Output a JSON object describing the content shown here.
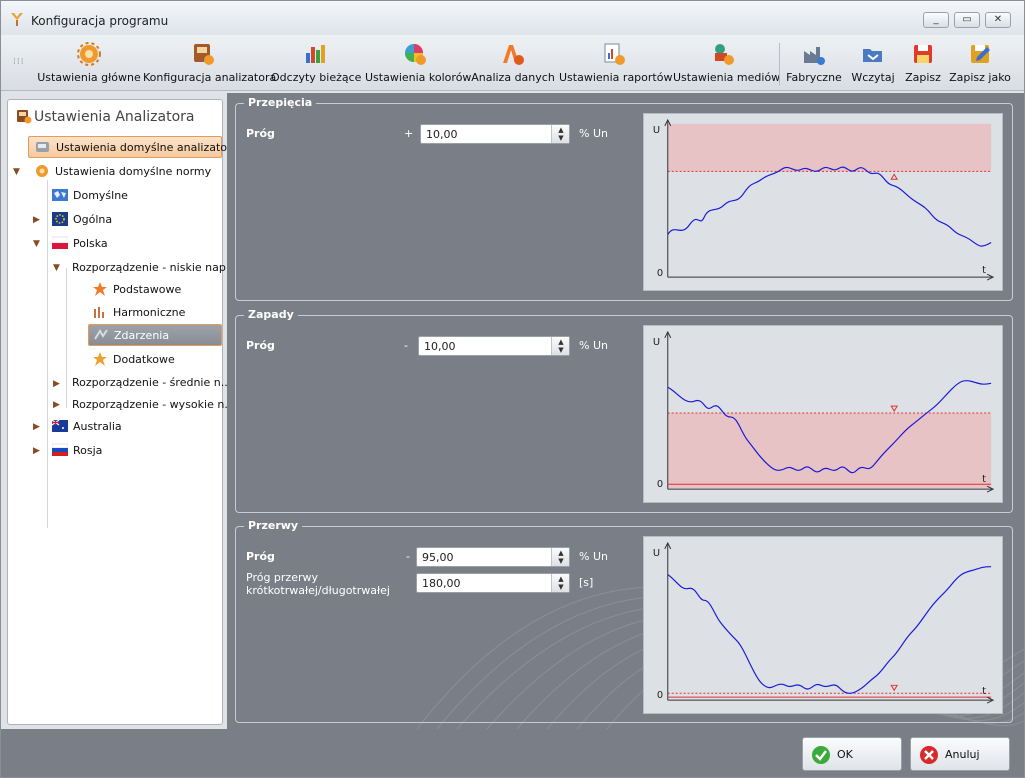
{
  "window": {
    "title": "Konfiguracja programu",
    "controls": [
      "_",
      "▭",
      "✕"
    ]
  },
  "toolbar": {
    "items": [
      {
        "label": "Ustawienia główne",
        "icon": "gear-settings-icon"
      },
      {
        "label": "Konfiguracja analizatora",
        "icon": "analyzer-config-icon"
      },
      {
        "label": "Odczyty bieżące",
        "icon": "current-readings-icon"
      },
      {
        "label": "Ustawienia kolorów",
        "icon": "color-wheel-icon"
      },
      {
        "label": "Analiza danych",
        "icon": "data-analysis-icon"
      },
      {
        "label": "Ustawienia raportów",
        "icon": "report-settings-icon"
      },
      {
        "label": "Ustawienia mediów",
        "icon": "media-settings-icon"
      },
      {
        "label": "Fabryczne",
        "icon": "factory-icon"
      },
      {
        "label": "Wczytaj",
        "icon": "load-icon"
      },
      {
        "label": "Zapisz",
        "icon": "save-icon"
      },
      {
        "label": "Zapisz jako",
        "icon": "save-as-icon"
      }
    ]
  },
  "tree": {
    "title": "Ustawienia Analizatora",
    "nodes": [
      {
        "label": "Ustawienia domyślne analizatora",
        "icon": "analyzer-icon"
      },
      {
        "label": "Ustawienia domyślne normy",
        "icon": "norm-gear-icon"
      },
      {
        "label": "Domyślne",
        "icon": "world-map-icon"
      },
      {
        "label": "Ogólna",
        "icon": "globe-eu-icon"
      },
      {
        "label": "Polska",
        "icon": "flag-poland-icon"
      },
      {
        "label": "Rozporządzenie - niskie nap...",
        "icon": ""
      },
      {
        "label": "Podstawowe",
        "icon": "star-gear-icon"
      },
      {
        "label": "Harmoniczne",
        "icon": "harmonics-icon"
      },
      {
        "label": "Zdarzenia",
        "icon": "events-icon"
      },
      {
        "label": "Dodatkowe",
        "icon": "star-icon"
      },
      {
        "label": "Rozporządzenie - średnie n...",
        "icon": ""
      },
      {
        "label": "Rozporządzenie - wysokie n...",
        "icon": ""
      },
      {
        "label": "Australia",
        "icon": "flag-australia-icon"
      },
      {
        "label": "Rosja",
        "icon": "flag-russia-icon"
      }
    ]
  },
  "sections": {
    "przepiecia": {
      "title": "Przepięcia",
      "label": "Próg",
      "sign": "+",
      "value": "10,00",
      "unit": "% Un"
    },
    "zapady": {
      "title": "Zapady",
      "label": "Próg",
      "sign": "-",
      "value": "10,00",
      "unit": "% Un"
    },
    "przerwy": {
      "title": "Przerwy",
      "label": "Próg",
      "sign": "-",
      "value": "95,00",
      "unit": "% Un",
      "label2_line1": "Próg przerwy",
      "label2_line2": "krótkotrwałej/długotrwałej",
      "value2": "180,00",
      "unit2": "[s]"
    }
  },
  "chart_axes": {
    "y": "U",
    "x": "t",
    "zero": "0"
  },
  "buttons": {
    "ok": "OK",
    "cancel": "Anuluj"
  },
  "colors": {
    "accent": "#e59a5a",
    "panel": "#7a7f87",
    "threshold": "#e03030",
    "signal": "#1a1ad8",
    "band": "#e7c3c6"
  }
}
